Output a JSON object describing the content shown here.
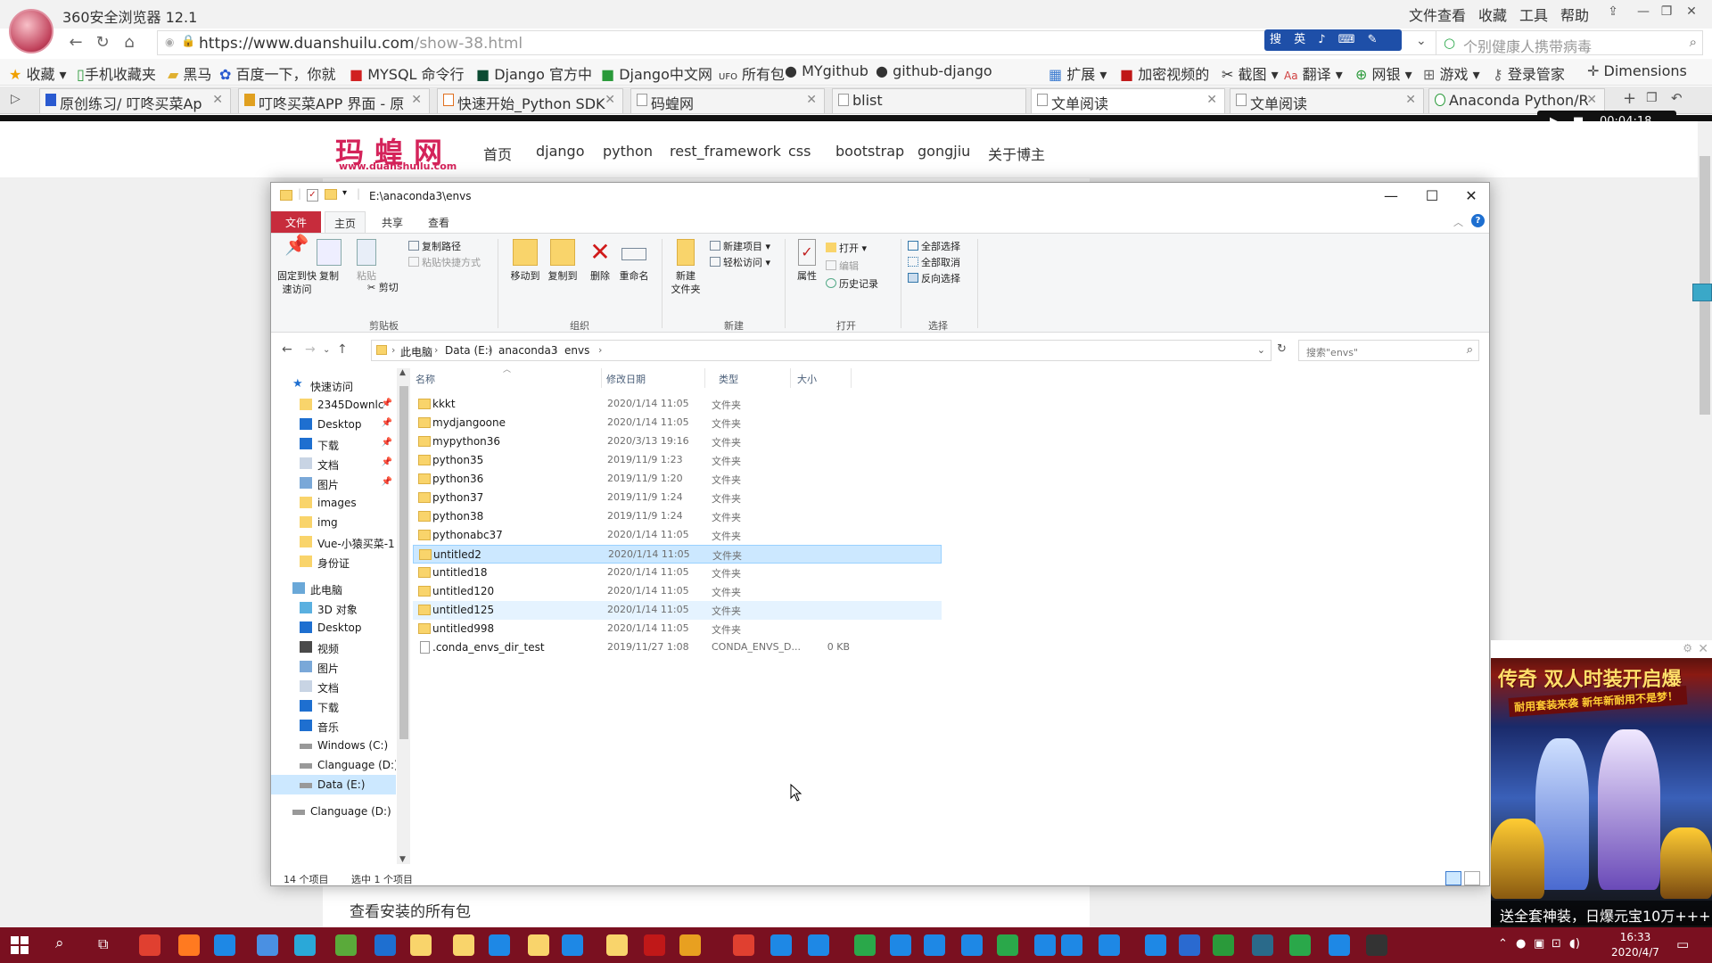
{
  "browser": {
    "title": "360安全浏览器 12.1",
    "menu": [
      "文件",
      "查看",
      "收藏",
      "工具",
      "帮助"
    ],
    "url_host": "https://www.duanshuilu.com",
    "url_path": "/show-38.html",
    "ime": "搜 英 ♪ ⌨ ✎",
    "search_placeholder": "个别健康人携带病毒",
    "favorites": [
      "收藏",
      "手机收藏夹",
      "黑马",
      "百度一下，你就",
      "MYSQL 命令行",
      "Django 官方中",
      "Django中文网",
      "所有包",
      "MYgithub",
      "github-django"
    ],
    "favorites_right": [
      "扩展",
      "加密视频的",
      "截图",
      "翻译",
      "网银",
      "游戏",
      "登录管家",
      "Dimensions"
    ],
    "tabs": [
      {
        "label": "原创练习/ 叮咚买菜Ap",
        "active": false
      },
      {
        "label": "叮咚买菜APP 界面 - 原",
        "active": false
      },
      {
        "label": "快速开始_Python SDK",
        "active": false
      },
      {
        "label": "码蝗网",
        "active": false
      },
      {
        "label": "blist",
        "active": false
      },
      {
        "label": "文单阅读",
        "active": true
      },
      {
        "label": "文单阅读",
        "active": false
      },
      {
        "label": "Anaconda Python/R",
        "active": false
      }
    ],
    "video_time": "00:04:18"
  },
  "site": {
    "logo": "玛蝗网",
    "logo_sub": "www.duanshuilu.com",
    "nav": [
      "首页",
      "django",
      "python",
      "rest_framework",
      "css",
      "bootstrap",
      "gongjiu",
      "关于博主"
    ],
    "content_text": "查看安装的所有包"
  },
  "explorer": {
    "title_path": "E:\\anaconda3\\envs",
    "ribbon_tabs": [
      "文件",
      "主页",
      "共享",
      "查看"
    ],
    "ribbon": {
      "pin": "固定到快\n速访问",
      "copy": "复制",
      "paste": "粘贴",
      "copy_path": "复制路径",
      "paste_shortcut": "粘贴快捷方式",
      "cut": "剪切",
      "clipboard": "剪贴板",
      "move_to": "移动到",
      "copy_to": "复制到",
      "delete": "删除",
      "rename": "重命名",
      "organize": "组织",
      "new_folder": "新建\n文件夹",
      "new_item": "新建项目",
      "easy_access": "轻松访问",
      "new": "新建",
      "properties": "属性",
      "open": "打开",
      "edit": "编辑",
      "history": "历史记录",
      "open_group": "打开",
      "select_all": "全部选择",
      "select_none": "全部取消",
      "invert": "反向选择",
      "select_group": "选择"
    },
    "breadcrumb": [
      "此电脑",
      "Data (E:)",
      "anaconda3",
      "envs"
    ],
    "search_placeholder": "搜索\"envs\"",
    "tree": [
      {
        "label": "快速访问",
        "type": "quick",
        "indent": 0
      },
      {
        "label": "2345Downlc",
        "type": "folder",
        "indent": 1,
        "pin": true
      },
      {
        "label": "Desktop",
        "type": "desktop",
        "indent": 1,
        "pin": true
      },
      {
        "label": "下载",
        "type": "download",
        "indent": 1,
        "pin": true
      },
      {
        "label": "文档",
        "type": "doc",
        "indent": 1,
        "pin": true
      },
      {
        "label": "图片",
        "type": "pic",
        "indent": 1,
        "pin": true
      },
      {
        "label": "images",
        "type": "folder",
        "indent": 1
      },
      {
        "label": "img",
        "type": "folder",
        "indent": 1
      },
      {
        "label": "Vue-小猿买菜-1",
        "type": "folder",
        "indent": 1
      },
      {
        "label": "身份证",
        "type": "folder",
        "indent": 1
      },
      {
        "label": "此电脑",
        "type": "pc",
        "indent": 0
      },
      {
        "label": "3D 对象",
        "type": "cube",
        "indent": 1
      },
      {
        "label": "Desktop",
        "type": "desktop",
        "indent": 1
      },
      {
        "label": "视频",
        "type": "video",
        "indent": 1
      },
      {
        "label": "图片",
        "type": "pic",
        "indent": 1
      },
      {
        "label": "文档",
        "type": "doc",
        "indent": 1
      },
      {
        "label": "下载",
        "type": "download",
        "indent": 1
      },
      {
        "label": "音乐",
        "type": "music",
        "indent": 1
      },
      {
        "label": "Windows (C:)",
        "type": "drive",
        "indent": 1
      },
      {
        "label": "Clanguage (D:)",
        "type": "drive",
        "indent": 1
      },
      {
        "label": "Data (E:)",
        "type": "drive",
        "indent": 1,
        "selected": true
      },
      {
        "label": "Clanguage (D:)",
        "type": "drive",
        "indent": 0
      }
    ],
    "columns": [
      "名称",
      "修改日期",
      "类型",
      "大小"
    ],
    "files": [
      {
        "name": "kkkt",
        "date": "2020/1/14 11:05",
        "type": "文件夹",
        "size": ""
      },
      {
        "name": "mydjangoone",
        "date": "2020/1/14 11:05",
        "type": "文件夹",
        "size": ""
      },
      {
        "name": "mypython36",
        "date": "2020/3/13 19:16",
        "type": "文件夹",
        "size": ""
      },
      {
        "name": "python35",
        "date": "2019/11/9 1:23",
        "type": "文件夹",
        "size": ""
      },
      {
        "name": "python36",
        "date": "2019/11/9 1:20",
        "type": "文件夹",
        "size": ""
      },
      {
        "name": "python37",
        "date": "2019/11/9 1:24",
        "type": "文件夹",
        "size": ""
      },
      {
        "name": "python38",
        "date": "2019/11/9 1:24",
        "type": "文件夹",
        "size": ""
      },
      {
        "name": "pythonabc37",
        "date": "2020/1/14 11:05",
        "type": "文件夹",
        "size": ""
      },
      {
        "name": "untitled2",
        "date": "2020/1/14 11:05",
        "type": "文件夹",
        "size": "",
        "selected": true
      },
      {
        "name": "untitled18",
        "date": "2020/1/14 11:05",
        "type": "文件夹",
        "size": ""
      },
      {
        "name": "untitled120",
        "date": "2020/1/14 11:05",
        "type": "文件夹",
        "size": ""
      },
      {
        "name": "untitled125",
        "date": "2020/1/14 11:05",
        "type": "文件夹",
        "size": "",
        "hover": true
      },
      {
        "name": "untitled998",
        "date": "2020/1/14 11:05",
        "type": "文件夹",
        "size": ""
      },
      {
        "name": ".conda_envs_dir_test",
        "date": "2019/11/27 1:08",
        "type": "CONDA_ENVS_D...",
        "size": "0 KB",
        "file": true
      }
    ],
    "status_count": "14 个项目",
    "status_selected": "选中 1 个项目"
  },
  "ad": {
    "headline": "传奇 双人时装开启爆",
    "sub": "耐用套装来袭 新年新耐用不是梦！",
    "footer": "送全套神装，日爆元宝10万+++"
  },
  "taskbar": {
    "time": "16:33",
    "date": "2020/4/7"
  }
}
